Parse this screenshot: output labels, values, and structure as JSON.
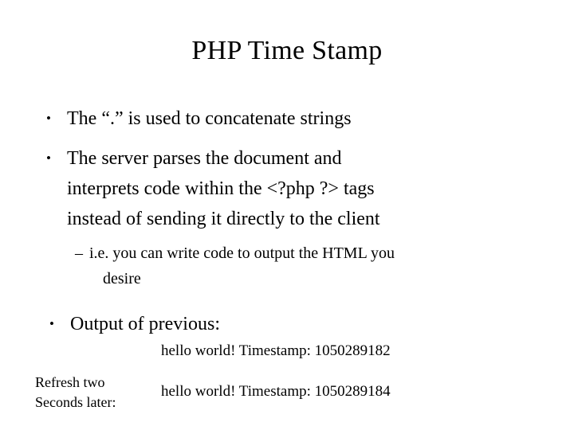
{
  "slide": {
    "title": "PHP Time Stamp",
    "background_color": "#ffffff",
    "text_color": "#000000",
    "bullets": [
      {
        "marker": "•",
        "lines": [
          "The “.” is used to concatenate strings"
        ]
      },
      {
        "marker": "•",
        "lines": [
          "The server parses the document and",
          "interprets code within the <?php  ?> tags",
          "instead of sending it directly to the client"
        ]
      }
    ],
    "subbullet": {
      "marker": "–",
      "lines": [
        "i.e. you can write code to output the HTML you",
        "desire"
      ]
    },
    "bullet_output": {
      "marker": "•",
      "label": "Output of previous:"
    },
    "output": {
      "line1": "hello world! Timestamp: 1050289182",
      "line2": "hello world! Timestamp: 1050289184",
      "refresh_note_line1": "Refresh two",
      "refresh_note_line2": "Seconds later:"
    }
  }
}
